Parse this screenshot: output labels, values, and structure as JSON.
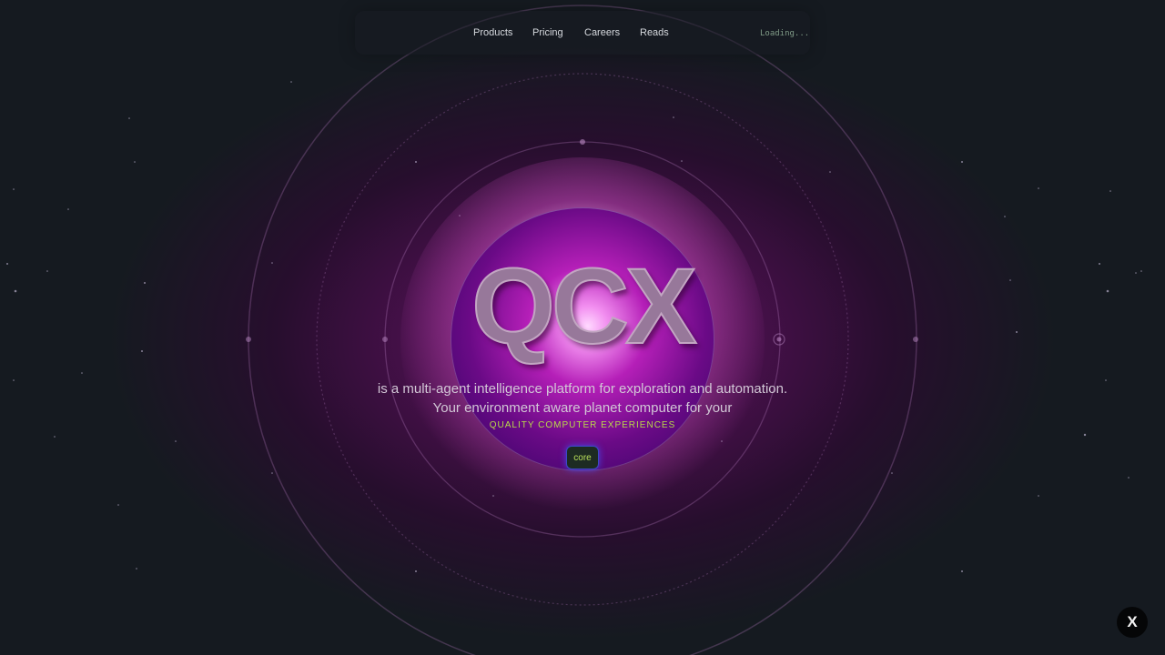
{
  "nav": {
    "items": [
      {
        "label": "Products"
      },
      {
        "label": "Pricing"
      },
      {
        "label": "Careers"
      },
      {
        "label": "Reads"
      }
    ],
    "status": "Loading..."
  },
  "hero": {
    "title": "QCX",
    "tagline": "is a multi-agent intelligence platform for exploration and automation. Your environment aware planet computer for your",
    "subtag": "QUALITY COMPUTER EXPERIENCES",
    "core_button": "core"
  },
  "social": {
    "x_label": "X",
    "icon": "x-logo-icon"
  },
  "colors": {
    "background": "#151a20",
    "accent_green": "#b8d94a",
    "orb_purple": "#b51fb8",
    "button_glow": "#3c49c9"
  }
}
